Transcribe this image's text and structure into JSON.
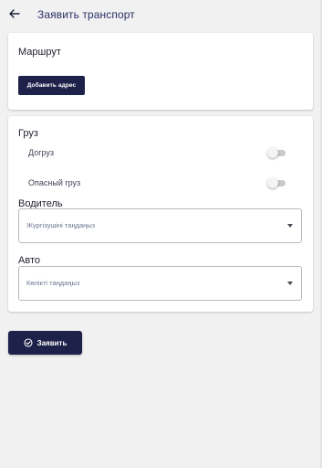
{
  "header": {
    "back_icon": "arrow-left-icon",
    "title": "Заявить транспорт"
  },
  "route": {
    "label": "Маршрут",
    "add_address_button": "Добавить адрес"
  },
  "cargo": {
    "label": "Груз",
    "toggles": [
      {
        "label": "Догруз",
        "checked": false
      },
      {
        "label": "Опасный груз",
        "checked": false
      }
    ]
  },
  "driver": {
    "label": "Водитель",
    "placeholder": "Жүргізушіні таңдаңыз"
  },
  "auto": {
    "label": "Авто",
    "placeholder": "Көлікті таңдаңыз"
  },
  "submit": {
    "icon": "check-circle-icon",
    "label": "Заявить"
  },
  "colors": {
    "accent": "#1e2149",
    "background": "#f1f1f2",
    "card": "#ffffff"
  }
}
